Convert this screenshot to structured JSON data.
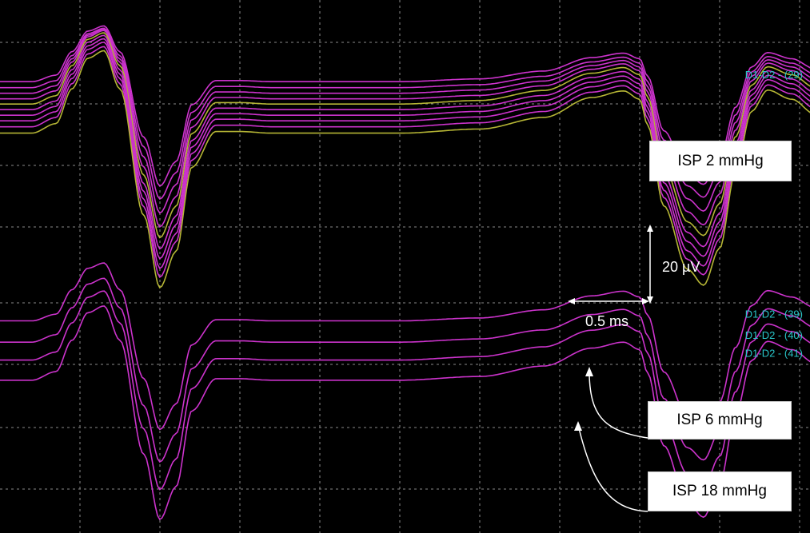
{
  "chart_data": {
    "type": "line",
    "title": "",
    "xlabel": "",
    "ylabel": "",
    "grid": true,
    "x_unit": "ms",
    "y_unit": "µV",
    "xlim": [
      0,
      5.55
    ],
    "ylim": [
      -119,
      15
    ],
    "scale_bars": {
      "amplitude_label": "20 µV",
      "time_label": "0.5 ms",
      "amplitude": 20,
      "time": 0.5
    },
    "group_labels": [
      {
        "id": "isp2",
        "text": "ISP 2 mmHg"
      },
      {
        "id": "isp6",
        "text": "ISP 6 mmHg"
      },
      {
        "id": "isp18",
        "text": "ISP 18 mmHg"
      }
    ],
    "series": [
      {
        "name": "D1-D2 - (29)",
        "group": "isp2",
        "color": "#cc33cc",
        "baseline": -2.6,
        "gain": 0.75,
        "labeled": true
      },
      {
        "name": "",
        "group": "isp2",
        "color": "#cc33cc",
        "baseline": -4.2,
        "gain": 0.8,
        "labeled": false
      },
      {
        "name": "",
        "group": "isp2",
        "color": "#cc33cc",
        "baseline": -5.7,
        "gain": 0.86,
        "labeled": false
      },
      {
        "name": "",
        "group": "isp2",
        "color": "#cc33cc",
        "baseline": -7.2,
        "gain": 0.92,
        "labeled": false
      },
      {
        "name": "",
        "group": "isp2",
        "color": "#b5b535",
        "baseline": -8.6,
        "gain": 0.96,
        "labeled": false
      },
      {
        "name": "",
        "group": "isp2",
        "color": "#cc33cc",
        "baseline": -10.1,
        "gain": 1.0,
        "labeled": false
      },
      {
        "name": "",
        "group": "isp2",
        "color": "#cc33cc",
        "baseline": -11.6,
        "gain": 1.03,
        "labeled": false
      },
      {
        "name": "",
        "group": "isp2",
        "color": "#cc33cc",
        "baseline": -13.1,
        "gain": 1.06,
        "labeled": false
      },
      {
        "name": "",
        "group": "isp2",
        "color": "#cc33cc",
        "baseline": -14.7,
        "gain": 1.08,
        "labeled": false
      },
      {
        "name": "",
        "group": "isp2",
        "color": "#b5b535",
        "baseline": -16.4,
        "gain": 1.11,
        "labeled": false
      },
      {
        "name": "D1-D2 - (39)",
        "group": "isp6",
        "color": "#cc33cc",
        "baseline": -66.7,
        "gain": 0.78,
        "labeled": true
      },
      {
        "name": "D1-D2 - (40)",
        "group": "isp6",
        "color": "#cc33cc",
        "baseline": -72.4,
        "gain": 0.86,
        "labeled": true
      },
      {
        "name": "D1-D2 - (41)",
        "group": "isp18",
        "color": "#cc33cc",
        "baseline": -77.2,
        "gain": 0.93,
        "labeled": true
      },
      {
        "name": "",
        "group": "isp18",
        "color": "#cc33cc",
        "baseline": -82.6,
        "gain": 1.0,
        "labeled": false
      }
    ],
    "waveform_template": {
      "x": [
        0.0,
        0.2,
        0.35,
        0.45,
        0.55,
        0.65,
        0.75,
        0.9,
        1.0,
        1.1,
        1.2,
        1.35,
        1.5,
        1.7,
        2.0,
        2.5,
        3.0,
        3.4,
        3.7,
        3.9,
        4.0,
        4.05,
        4.15,
        4.3,
        4.4,
        4.5,
        4.6,
        4.7,
        4.8,
        4.95,
        5.1,
        5.25,
        5.4,
        5.55
      ],
      "y": [
        0,
        0,
        2.3,
        10.7,
        18.1,
        19.9,
        10.7,
        -19.9,
        -37.3,
        -28.6,
        -8.2,
        0.4,
        0.4,
        0.0,
        0.0,
        0.0,
        1.0,
        3.8,
        8.6,
        10.2,
        8.2,
        1.9,
        -17.5,
        -32.9,
        -36.7,
        -27.8,
        -9.1,
        5.3,
        10.4,
        8.2,
        4.5,
        1.9,
        0.6,
        0.0
      ]
    }
  }
}
